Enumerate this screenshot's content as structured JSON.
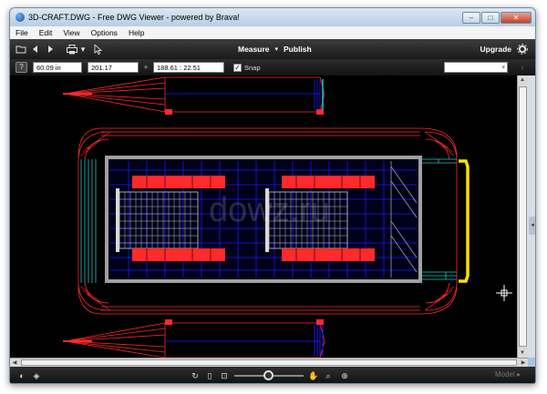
{
  "window": {
    "title": "3D-CRAFT.DWG - Free DWG Viewer - powered by Brava!"
  },
  "menu": [
    "File",
    "Edit",
    "View",
    "Options",
    "Help"
  ],
  "toolbar": {
    "measure_label": "Measure",
    "publish_label": "Publish",
    "upgrade_label": "Upgrade"
  },
  "coords": {
    "field1": "60.09 in",
    "field2": "201.17",
    "field3": "188.61 : 22.51",
    "snap_label": "Snap",
    "snap_checked": "✓"
  },
  "statusbar": {
    "model_label": "Model"
  },
  "watermark": "dowz.ru",
  "icons": {
    "open": "folder-open-icon",
    "back": "back-icon",
    "forward": "forward-icon",
    "print": "print-icon",
    "select": "pointer-icon",
    "gear": "gear-icon",
    "help": "help-icon",
    "rotate": "rotate-icon",
    "page": "page-icon",
    "fit": "fit-icon",
    "pan": "hand-icon",
    "zoom_window": "zoom-window-icon",
    "zoom": "zoom-icon"
  },
  "colors": {
    "canvas": "#000000",
    "drawing_red": "#ff2a2a",
    "drawing_blue": "#1a1aff",
    "drawing_cyan": "#18c8c8",
    "drawing_yellow": "#ffe000",
    "drawing_grey": "#a0a0a0"
  }
}
